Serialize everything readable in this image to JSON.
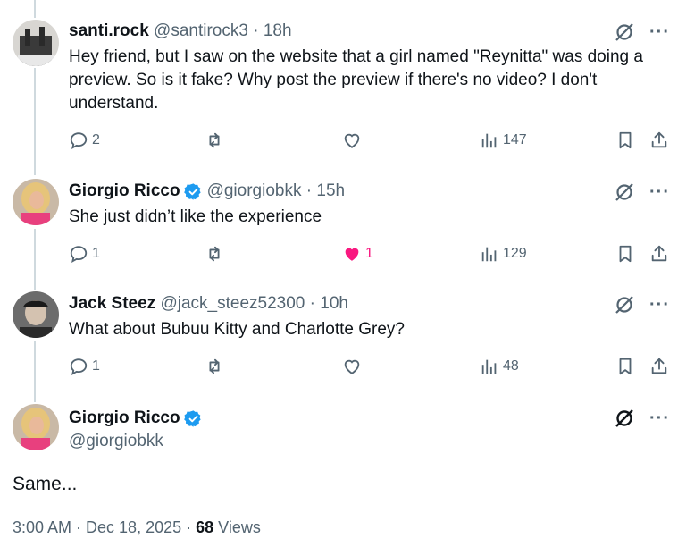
{
  "replies": [
    {
      "name": "santi.rock",
      "handle": "@santirock3",
      "sep": "·",
      "time": "18h",
      "verified": false,
      "text": "Hey friend, but I saw on the website that a girl named \"Reynitta\" was doing a preview. So is it fake? Why post the preview if there's no video? I don't understand.",
      "replies": "2",
      "reposts": "",
      "likes": "",
      "views": "147"
    },
    {
      "name": "Giorgio Ricco",
      "handle": "@giorgiobkk",
      "sep": "·",
      "time": "15h",
      "verified": true,
      "text": "She just didn’t like the experience",
      "replies": "1",
      "reposts": "",
      "likes": "1",
      "liked": true,
      "views": "129"
    },
    {
      "name": "Jack Steez",
      "handle": "@jack_steez52300",
      "sep": "·",
      "time": "10h",
      "verified": false,
      "text": "What about Bubuu Kitty and Charlotte Grey?",
      "replies": "1",
      "reposts": "",
      "likes": "",
      "views": "48"
    }
  ],
  "main_post": {
    "name": "Giorgio Ricco",
    "handle": "@giorgiobkk",
    "verified": true,
    "text": "Same...",
    "timestamp": "3:00 AM · Dec 18, 2025 ·",
    "views_count": "68",
    "views_label": "Views"
  },
  "icons": {
    "reply": "speech-bubble-icon",
    "repost": "repost-arrows-icon",
    "like": "heart-icon",
    "views": "bar-chart-icon",
    "bookmark": "bookmark-icon",
    "share": "share-upload-icon",
    "grok": "grok-slash-circle-icon",
    "more": "more-dots-icon"
  },
  "colors": {
    "verified": "#1d9bf0",
    "like_active": "#f91880",
    "secondary_text": "#536471",
    "thread_line": "#cfd9de"
  }
}
